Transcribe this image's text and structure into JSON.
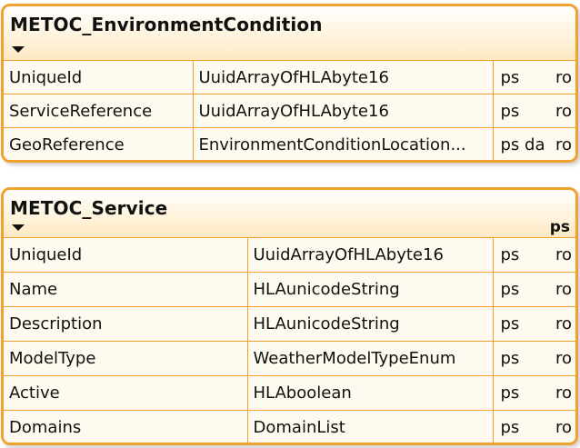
{
  "classes": [
    {
      "title": "METOC_EnvironmentCondition",
      "header_tag": "",
      "attributes": [
        {
          "name": "UniqueId",
          "type": "UuidArrayOfHLAbyte16",
          "flags": "ps",
          "access": "ro"
        },
        {
          "name": "ServiceReference",
          "type": "UuidArrayOfHLAbyte16",
          "flags": "ps",
          "access": "ro"
        },
        {
          "name": "GeoReference",
          "type": "EnvironmentConditionLocation...",
          "flags": "ps da",
          "access": "ro"
        }
      ]
    },
    {
      "title": "METOC_Service",
      "header_tag": "ps",
      "attributes": [
        {
          "name": "UniqueId",
          "type": "UuidArrayOfHLAbyte16",
          "flags": "ps",
          "access": "ro"
        },
        {
          "name": "Name",
          "type": "HLAunicodeString",
          "flags": "ps",
          "access": "ro"
        },
        {
          "name": "Description",
          "type": "HLAunicodeString",
          "flags": "ps",
          "access": "ro"
        },
        {
          "name": "ModelType",
          "type": "WeatherModelTypeEnum",
          "flags": "ps",
          "access": "ro"
        },
        {
          "name": "Active",
          "type": "HLAboolean",
          "flags": "ps",
          "access": "ro"
        },
        {
          "name": "Domains",
          "type": "DomainList",
          "flags": "ps",
          "access": "ro"
        }
      ]
    }
  ],
  "colors": {
    "border": "#f2a12f",
    "header_bg": "#fde8c2",
    "body_bg": "#fffaf0"
  },
  "icons": {
    "collapse": "triangle-down-icon"
  }
}
